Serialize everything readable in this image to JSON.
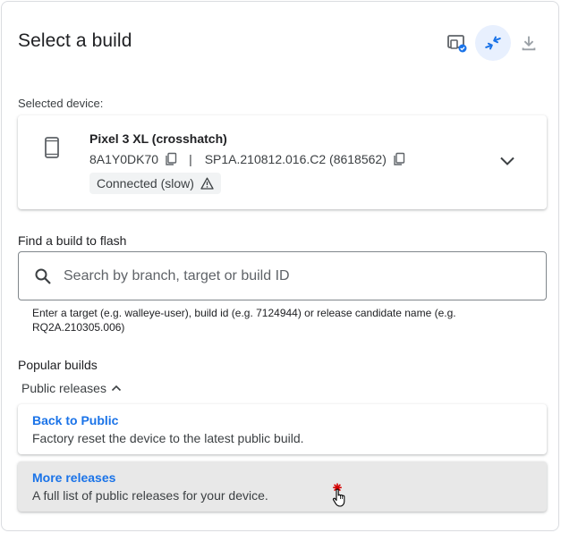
{
  "header": {
    "title": "Select a build",
    "device_button_icon": "device-settings-icon",
    "connect_button_icon": "compress-arrows-icon",
    "download_button_icon": "download-icon"
  },
  "device": {
    "section_label": "Selected device:",
    "name": "Pixel 3 XL (crosshatch)",
    "serial": "8A1Y0DK70",
    "separator": "|",
    "build": "SP1A.210812.016.C2 (8618562)",
    "status": "Connected (slow)"
  },
  "search": {
    "label": "Find a build to flash",
    "placeholder": "Search by branch, target or build ID",
    "value": "",
    "hint": "Enter a target (e.g. walleye-user), build id (e.g. 7124944) or release candidate name (e.g. RQ2A.210305.006)"
  },
  "popular": {
    "label": "Popular builds",
    "toggle_label": "Public releases",
    "items": [
      {
        "title": "Back to Public",
        "description": "Factory reset the device to the latest public build."
      },
      {
        "title": "More releases",
        "description": "A full list of public releases for your device."
      }
    ]
  },
  "colors": {
    "accent": "#1a73e8",
    "accent_bg": "#e8f0fe",
    "hover_bg": "#e8e8e8"
  }
}
